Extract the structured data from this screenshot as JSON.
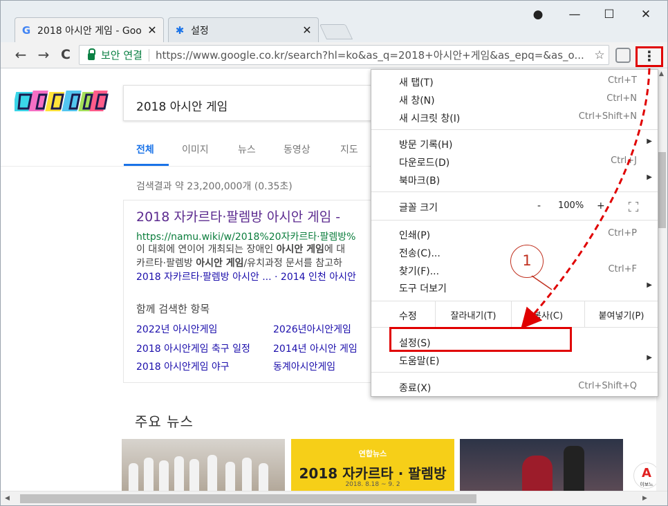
{
  "browser": {
    "tabs": [
      {
        "title": "2018 아시안 게임 - Goo",
        "close": "✕",
        "icon": "google-icon"
      },
      {
        "title": "설정",
        "close": "✕",
        "icon": "gear-icon"
      }
    ],
    "window_controls": {
      "account": "●",
      "minimize": "—",
      "maximize": "☐",
      "close": "✕"
    },
    "nav": {
      "back": "←",
      "forward": "→",
      "reload": "C"
    },
    "secure_label": "보안 연결",
    "url": "https://www.google.co.kr/search?hl=ko&as_q=2018+아시안+게임&as_epq=&as_o...",
    "star": "☆",
    "menu_button": "⋮"
  },
  "google": {
    "query": "2018 아시안 게임",
    "tabs": [
      "전체",
      "이미지",
      "뉴스",
      "동영상",
      "지도"
    ],
    "stats": "검색결과 약 23,200,000개 (0.35초)",
    "result": {
      "title": "2018 자카르타·팔렘방 아시안 게임 -",
      "url": "https://namu.wiki/w/2018%20자카르타·팔렘방%",
      "snippet_1a": "이 대회에 연이어 개최되는 장애인 ",
      "snippet_1b": "아시안 게임",
      "snippet_1c": "에 대",
      "snippet_2a": "카르타·팔렘방 ",
      "snippet_2b": "아시안 게임",
      "snippet_2c": "/유치과정 문서를 참고하",
      "links": "2018 자카르타·팔렘방 아시안 ... · 2014 인천 아시안"
    },
    "related": {
      "title": "함께 검색한 항목",
      "items": [
        "2022년 아시안게임",
        "2026년아시안게임",
        "2018 아시안게임 축구 일정",
        "2014년 아시안 게임",
        "2018 아시안게임 야구",
        "동계아시안게임"
      ]
    },
    "news": {
      "title": "주요 뉴스",
      "card2_brand": "연합뉴스",
      "card2_headline": "2018 자카르타 · 팔렘방",
      "card2_date": "2018. 8.18 ~ 9. 2"
    },
    "badge_text": "이보느"
  },
  "menu": {
    "new_tab": {
      "label": "새 탭(T)",
      "shortcut": "Ctrl+T"
    },
    "new_window": {
      "label": "새 창(N)",
      "shortcut": "Ctrl+N"
    },
    "incognito": {
      "label": "새 시크릿 창(I)",
      "shortcut": "Ctrl+Shift+N"
    },
    "history": {
      "label": "방문 기록(H)"
    },
    "downloads": {
      "label": "다운로드(D)",
      "shortcut": "Ctrl+J"
    },
    "bookmarks": {
      "label": "북마크(B)"
    },
    "zoom": {
      "label": "글꼴 크기",
      "minus": "-",
      "level": "100%",
      "plus": "+"
    },
    "print": {
      "label": "인쇄(P)",
      "shortcut": "Ctrl+P"
    },
    "cast": {
      "label": "전송(C)..."
    },
    "find": {
      "label": "찾기(F)...",
      "shortcut": "Ctrl+F"
    },
    "more_tools": {
      "label": "도구 더보기"
    },
    "edit": {
      "label": "수정",
      "cut": "잘라내기(T)",
      "copy": "복사(C)",
      "paste": "붙여넣기(P)"
    },
    "settings": {
      "label": "설정(S)"
    },
    "help": {
      "label": "도움말(E)"
    },
    "exit": {
      "label": "종료(X)",
      "shortcut": "Ctrl+Shift+Q"
    },
    "submenu_arrow": "▶"
  },
  "annotation": {
    "step": "1"
  },
  "colors": {
    "highlight": "#e00000",
    "link": "#1a0dab",
    "accent": "#1a73e8",
    "secure": "#0b8043"
  }
}
